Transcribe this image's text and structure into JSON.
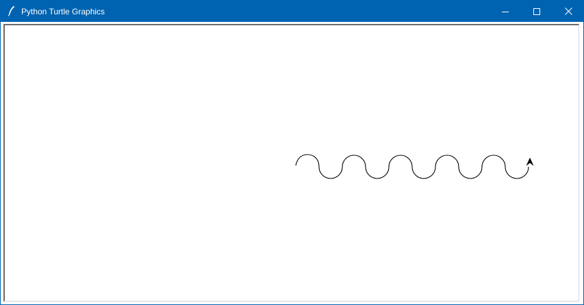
{
  "window": {
    "title": "Python Turtle Graphics",
    "app_icon": "feather-icon",
    "titlebar_color": "#0063b1",
    "controls": [
      "minimize-icon",
      "maximize-icon",
      "close-icon"
    ]
  },
  "canvas": {
    "background": "#ffffff",
    "pen_color": "#000000",
    "drawing": "wave-path",
    "cursor": "turtle-arrow-icon"
  }
}
